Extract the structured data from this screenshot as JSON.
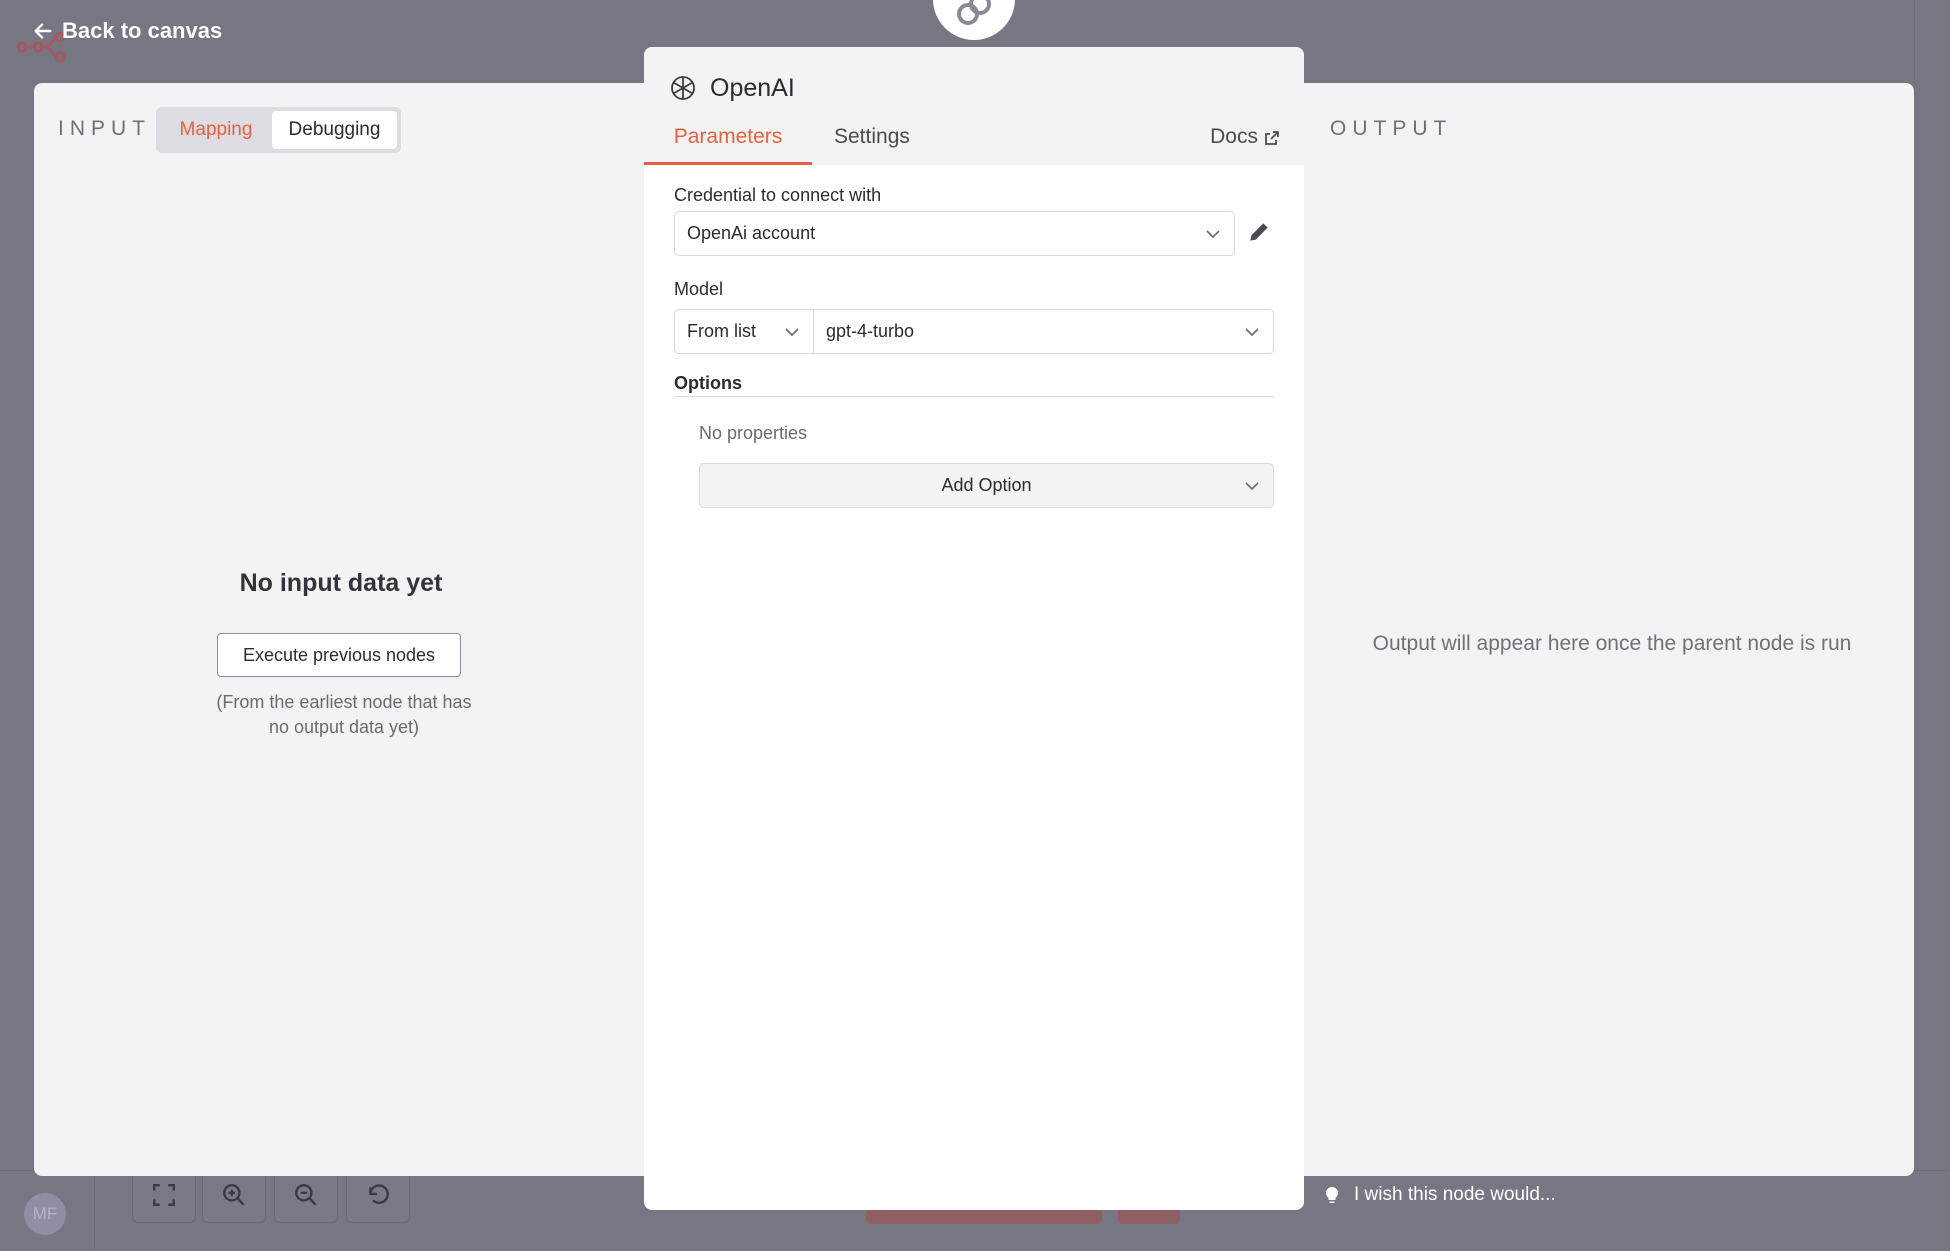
{
  "nav": {
    "back_label": "Back to canvas"
  },
  "input_panel": {
    "label": "INPUT",
    "modes": [
      {
        "label": "Mapping",
        "active": false
      },
      {
        "label": "Debugging",
        "active": true
      }
    ],
    "empty_title": "No input data yet",
    "execute_button": "Execute previous nodes",
    "execute_hint": "(From the earliest node that has no output data yet)"
  },
  "node": {
    "title": "OpenAI",
    "icon": "openai-icon",
    "tabs": {
      "parameters": "Parameters",
      "settings": "Settings",
      "docs": "Docs"
    },
    "credential": {
      "label": "Credential to connect with",
      "value": "OpenAi account"
    },
    "model": {
      "label": "Model",
      "mode": "From list",
      "value": "gpt-4-turbo"
    },
    "options": {
      "label": "Options",
      "empty": "No properties",
      "add_button": "Add Option"
    }
  },
  "output_panel": {
    "label": "OUTPUT",
    "hint": "Output will appear here once the parent node is run"
  },
  "canvas_controls": {
    "avatar_initials": "MF"
  },
  "feedback": {
    "label": "I wish this node would..."
  },
  "colors": {
    "accent": "#e9613c",
    "overlay": "#777683",
    "panel": "#f3f3f5"
  }
}
